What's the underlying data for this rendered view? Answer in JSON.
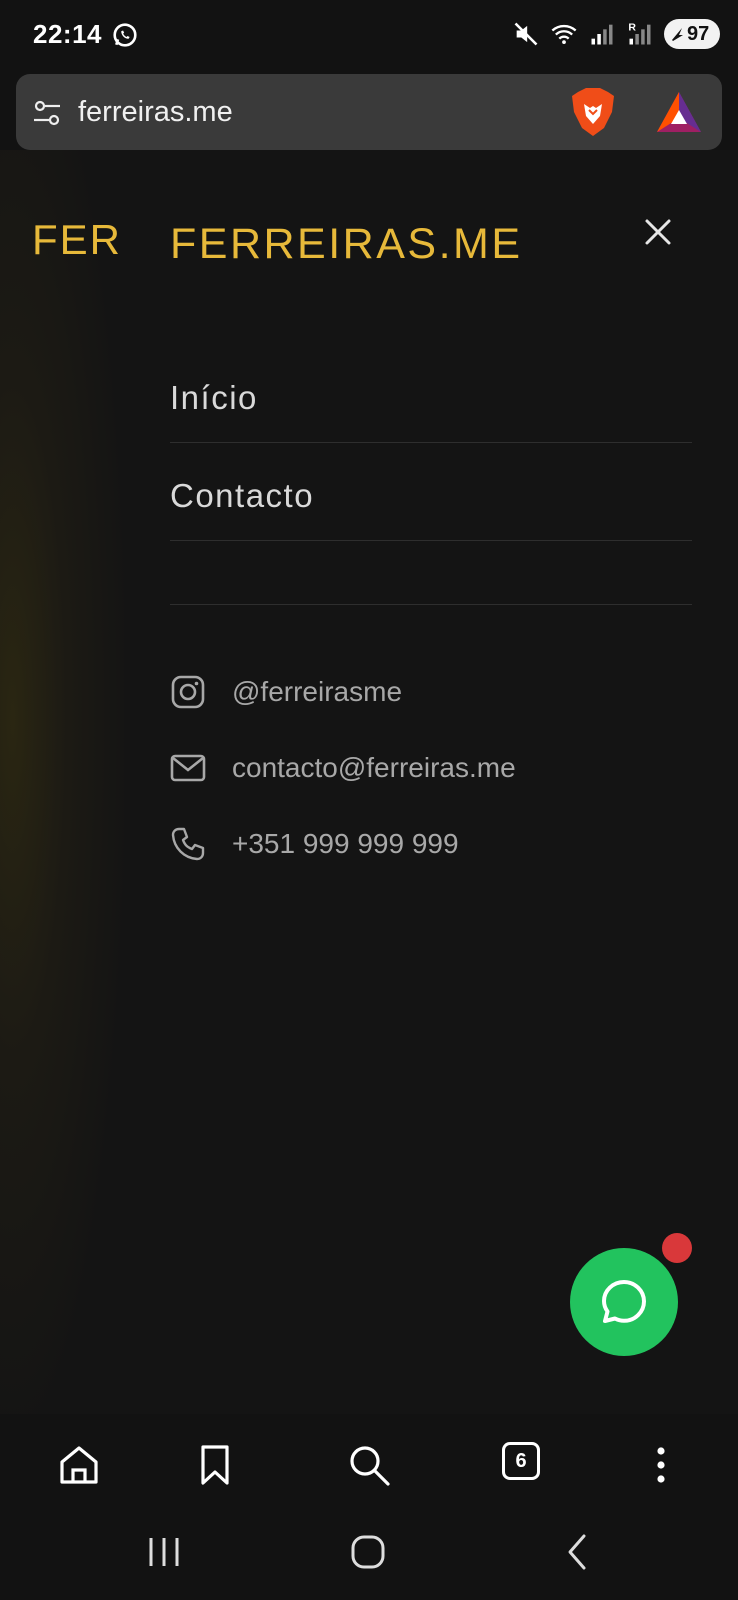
{
  "status_bar": {
    "time": "22:14",
    "battery": "97",
    "icons": [
      "whatsapp-icon",
      "mute-icon",
      "wifi-icon",
      "signal-icon",
      "signal-roaming-icon",
      "battery-saver-icon"
    ]
  },
  "browser": {
    "url": "ferreiras.me",
    "tab_count": "6",
    "toolbar_icons": [
      "home-icon",
      "bookmark-icon",
      "search-icon",
      "tabs-icon",
      "more-icon"
    ]
  },
  "page": {
    "logo_partial": "FER"
  },
  "drawer": {
    "logo": "FERREIRAS.ME",
    "nav": [
      {
        "label": "Início"
      },
      {
        "label": "Contacto"
      }
    ],
    "contacts": [
      {
        "icon": "instagram-icon",
        "text": "@ferreirasme"
      },
      {
        "icon": "mail-icon",
        "text": "contacto@ferreiras.me"
      },
      {
        "icon": "phone-icon",
        "text": "+351 999 999 999"
      }
    ]
  },
  "colors": {
    "accent": "#e7b93a",
    "whatsapp": "#22c35e",
    "badge": "#d9383a",
    "background": "#141414"
  }
}
